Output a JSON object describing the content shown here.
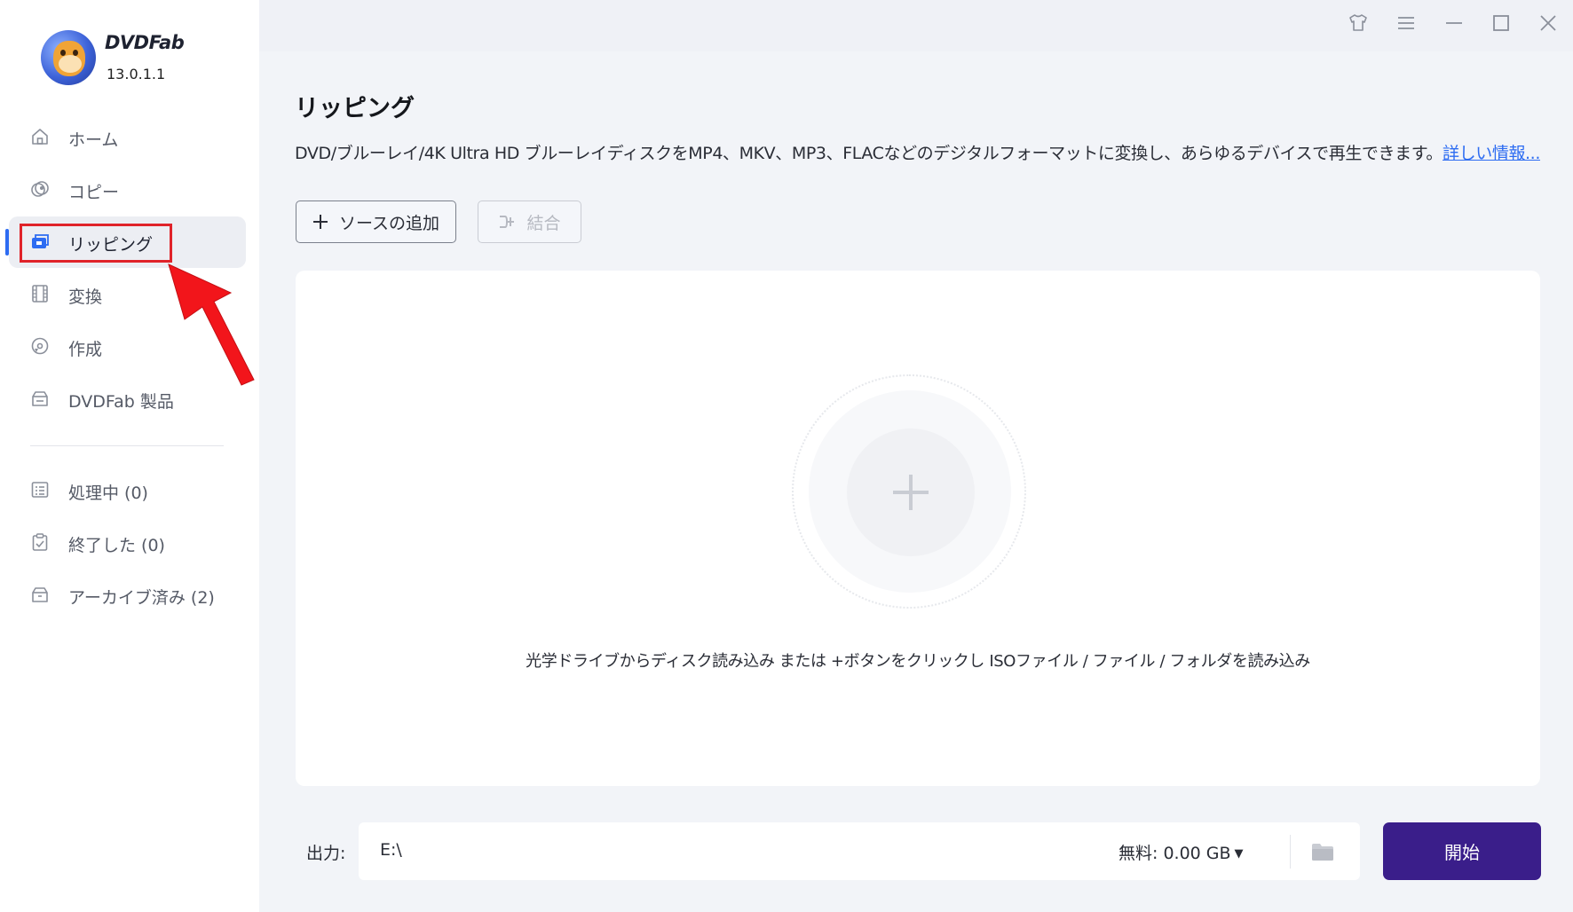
{
  "app": {
    "name": "DVDFab",
    "version": "13.0.1.1"
  },
  "sidebar": {
    "items": [
      {
        "label": "ホーム",
        "icon": "home-icon"
      },
      {
        "label": "コピー",
        "icon": "copy-disc-icon"
      },
      {
        "label": "リッピング",
        "icon": "ripper-icon",
        "active": true
      },
      {
        "label": "変換",
        "icon": "film-icon"
      },
      {
        "label": "作成",
        "icon": "creator-disc-icon"
      },
      {
        "label": "DVDFab 製品",
        "icon": "products-icon"
      }
    ],
    "task_items": [
      {
        "label": "処理中 (0)",
        "icon": "processing-list-icon"
      },
      {
        "label": "終了した (0)",
        "icon": "finished-clipboard-icon"
      },
      {
        "label": "アーカイブ済み (2)",
        "icon": "archive-icon"
      }
    ]
  },
  "main": {
    "title": "リッピング",
    "description": "DVD/ブルーレイ/4K Ultra HD ブルーレイディスクをMP4、MKV、MP3、FLACなどのデジタルフォーマットに変換し、あらゆるデバイスで再生できます。",
    "more_link": "詳しい情報...",
    "add_source_label": "ソースの追加",
    "merge_label": "結合",
    "drop_hint": "光学ドライブからディスク読み込み または +ボタンをクリックし ISOファイル / ファイル / フォルダを読み込み"
  },
  "output": {
    "label": "出力:",
    "path": "E:\\",
    "free_space": "無料: 0.00 GB",
    "start_label": "開始"
  },
  "colors": {
    "accent": "#2d6cf2",
    "start_button": "#3a1e8a",
    "highlight_annotation": "#e0232a"
  }
}
